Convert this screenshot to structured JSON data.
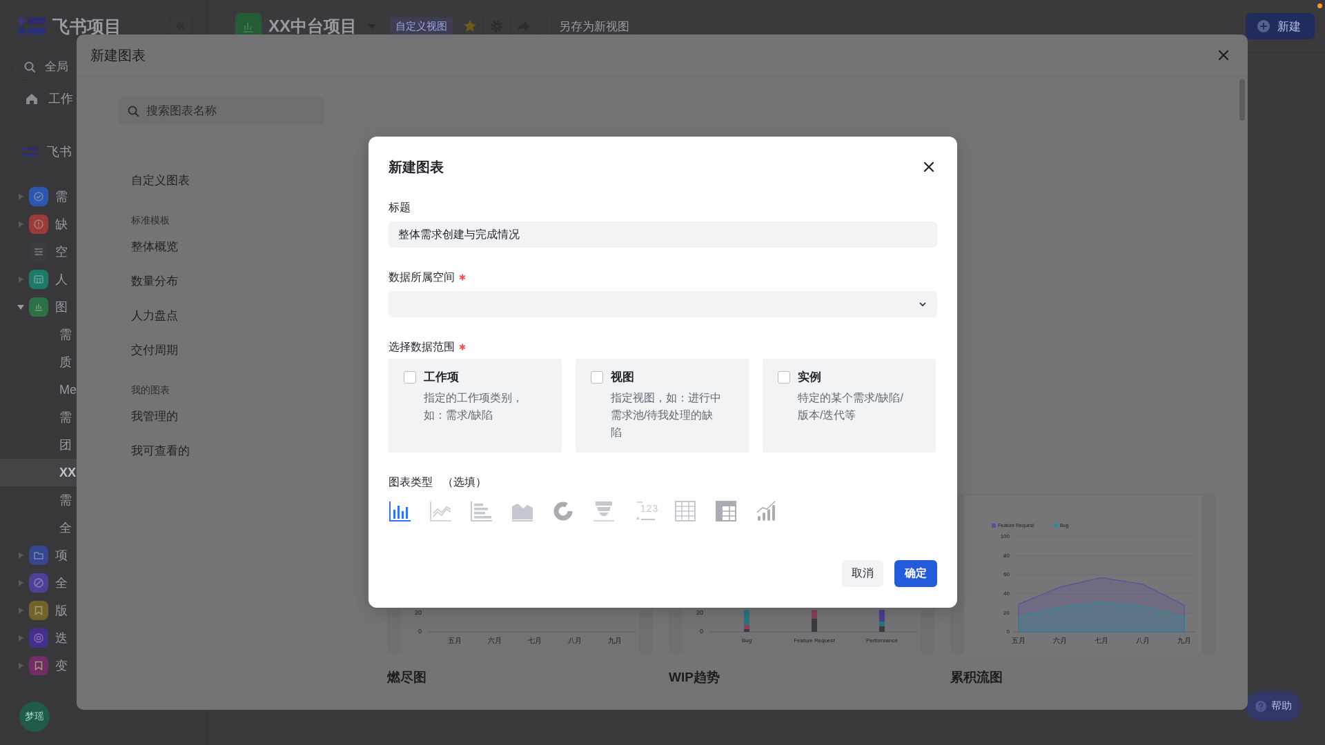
{
  "app": {
    "logo": "飞书项目",
    "search": {
      "placeholder": "全局"
    },
    "workbench": "工作",
    "space": "飞书",
    "tree": [
      {
        "label": "需",
        "kind": "check",
        "color": "#2c56b0",
        "expanded": false
      },
      {
        "label": "缺",
        "kind": "alert",
        "color": "#9b3a36",
        "expanded": false
      },
      {
        "label": "空",
        "kind": "sliders",
        "color": "#3a3a40"
      },
      {
        "label": "人",
        "kind": "calendar",
        "color": "#1d7a68",
        "expanded": false
      },
      {
        "label": "图",
        "kind": "chart",
        "color": "#2d7048",
        "expanded": true,
        "children": [
          {
            "label": "需",
            "selected": false
          },
          {
            "label": "质",
            "selected": false
          },
          {
            "label": "Me",
            "selected": false
          },
          {
            "label": "需",
            "selected": false
          },
          {
            "label": "团",
            "selected": false
          },
          {
            "label": "XX",
            "selected": true
          },
          {
            "label": "需",
            "selected": false
          },
          {
            "label": "全",
            "selected": false
          }
        ]
      },
      {
        "label": "项",
        "kind": "folder",
        "color": "#34478f",
        "expanded": false
      },
      {
        "label": "全",
        "kind": "gauge",
        "color": "#4f3f96",
        "expanded": false
      },
      {
        "label": "版",
        "kind": "bookmark",
        "color": "#74622c",
        "expanded": false
      },
      {
        "label": "迭",
        "kind": "target",
        "color": "#452f8c",
        "expanded": false
      },
      {
        "label": "变",
        "kind": "bookmark",
        "color": "#6f2f66",
        "expanded": false
      }
    ],
    "avatar": "梦瑶"
  },
  "top_bar": {
    "project": "XX中台项目",
    "view_tag": "自定义视图",
    "starred": true,
    "save_as": "另存为新视图",
    "new_button": "新建"
  },
  "help_button": "帮助",
  "chart_dialog": {
    "title": "新建图表",
    "search": {
      "placeholder": "搜索图表名称"
    },
    "nav": [
      {
        "kind": "item",
        "label": "自定义图表"
      },
      {
        "kind": "section",
        "label": "标准模板"
      },
      {
        "kind": "item",
        "label": "整体概览"
      },
      {
        "kind": "item",
        "label": "数量分布"
      },
      {
        "kind": "item",
        "label": "人力盘点"
      },
      {
        "kind": "item",
        "label": "交付周期"
      },
      {
        "kind": "section",
        "label": "我的图表"
      },
      {
        "kind": "item",
        "label": "我管理的"
      },
      {
        "kind": "item",
        "label": "我可查看的"
      }
    ],
    "templates": [
      {
        "title": "燃尽图",
        "preview": {
          "kind": "axes",
          "y_ticks": [
            "20",
            "0"
          ],
          "x_labels": [
            "五月",
            "六月",
            "七月",
            "八月",
            "九月"
          ]
        }
      },
      {
        "title": "WIP趋势",
        "preview": {
          "kind": "stacked-bars",
          "y_ticks": [
            "20",
            "0"
          ],
          "x_labels": [
            "Bug",
            "Feature Request",
            "Performance"
          ]
        }
      },
      {
        "title": "累积流图",
        "preview": {
          "kind": "area",
          "chart_data": {
            "type": "area",
            "categories": [
              "五月",
              "六月",
              "七月",
              "八月",
              "九月"
            ],
            "series": [
              {
                "name": "Feature Request",
                "color": "#5a4fa0",
                "values": [
                  29,
                  47,
                  57,
                  50,
                  28
                ]
              },
              {
                "name": "Bug",
                "color": "#2a8c96",
                "values": [
                  16,
                  26,
                  31,
                  27,
                  15
                ]
              }
            ],
            "ylim": [
              0,
              100
            ],
            "yticks": [
              0,
              20,
              40,
              60,
              80,
              100
            ],
            "grid": true,
            "legend": "top-left"
          }
        }
      }
    ]
  },
  "new_chart_form": {
    "title": "新建图表",
    "fields": [
      {
        "kind": "text",
        "label": "标题",
        "required": false,
        "value": "整体需求创建与完成情况"
      },
      {
        "kind": "select",
        "label": "数据所属空间",
        "required": true
      }
    ],
    "scope": {
      "label": "选择数据范围",
      "required": true,
      "options": [
        {
          "title": "工作项",
          "description": "指定的工作项类别，如：需求/缺陷",
          "checked": false
        },
        {
          "title": "视图",
          "description": "指定视图，如：进行中需求池/待我处理的缺陷",
          "checked": false
        },
        {
          "title": "实例",
          "description": "特定的某个需求/缺陷/版本/迭代等",
          "checked": false
        }
      ]
    },
    "chart_types": {
      "label": "图表类型",
      "hint": "（选填）",
      "items": [
        {
          "kind": "bar",
          "selected": true
        },
        {
          "kind": "line",
          "selected": false
        },
        {
          "kind": "horizontal-bar",
          "selected": false
        },
        {
          "kind": "area",
          "selected": false
        },
        {
          "kind": "donut",
          "selected": false
        },
        {
          "kind": "funnel",
          "selected": false
        },
        {
          "kind": "number",
          "glyph": "123",
          "selected": false
        },
        {
          "kind": "table",
          "selected": false
        },
        {
          "kind": "pivot-table",
          "selected": false
        },
        {
          "kind": "combo",
          "selected": false
        }
      ]
    },
    "buttons": [
      {
        "kind": "secondary",
        "label": "取消"
      },
      {
        "kind": "primary",
        "label": "确定"
      }
    ]
  }
}
